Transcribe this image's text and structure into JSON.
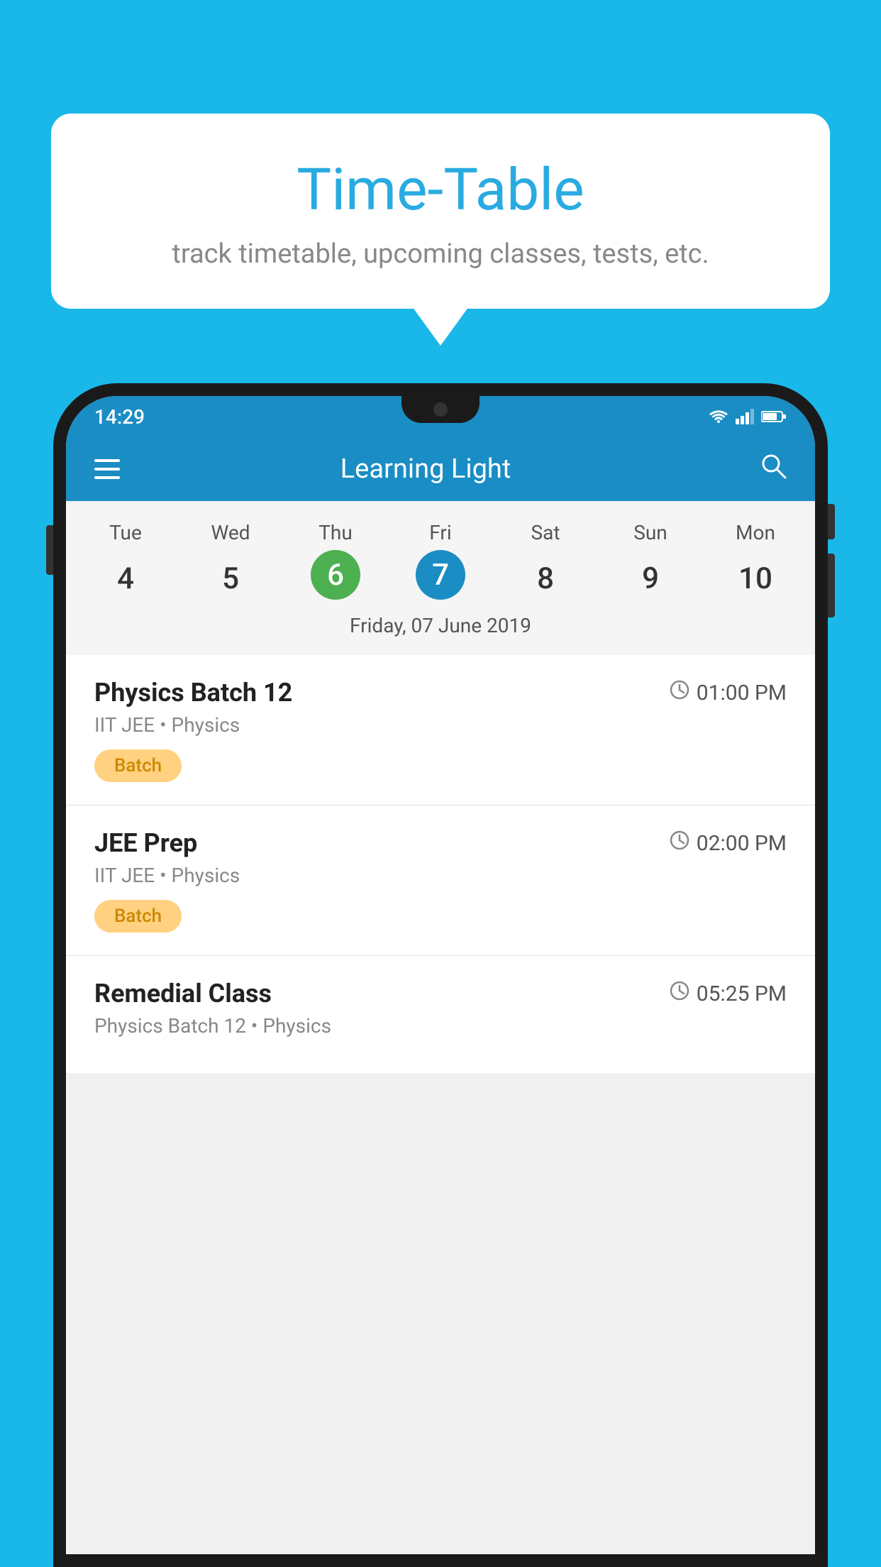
{
  "page": {
    "bg_color": "#1ab8e8"
  },
  "bubble": {
    "title": "Time-Table",
    "subtitle": "track timetable, upcoming classes, tests, etc."
  },
  "app_bar": {
    "title": "Learning Light"
  },
  "status_bar": {
    "time": "14:29"
  },
  "calendar": {
    "days": [
      {
        "name": "Tue",
        "num": "4"
      },
      {
        "name": "Wed",
        "num": "5"
      },
      {
        "name": "Thu",
        "num": "6",
        "state": "today"
      },
      {
        "name": "Fri",
        "num": "7",
        "state": "selected"
      },
      {
        "name": "Sat",
        "num": "8"
      },
      {
        "name": "Sun",
        "num": "9"
      },
      {
        "name": "Mon",
        "num": "10"
      }
    ],
    "selected_date": "Friday, 07 June 2019"
  },
  "schedule": [
    {
      "title": "Physics Batch 12",
      "time": "01:00 PM",
      "subtitle": "IIT JEE • Physics",
      "badge": "Batch"
    },
    {
      "title": "JEE Prep",
      "time": "02:00 PM",
      "subtitle": "IIT JEE • Physics",
      "badge": "Batch"
    },
    {
      "title": "Remedial Class",
      "time": "05:25 PM",
      "subtitle": "Physics Batch 12 • Physics",
      "badge": ""
    }
  ],
  "icons": {
    "hamburger": "≡",
    "search": "🔍",
    "clock": "🕐"
  }
}
